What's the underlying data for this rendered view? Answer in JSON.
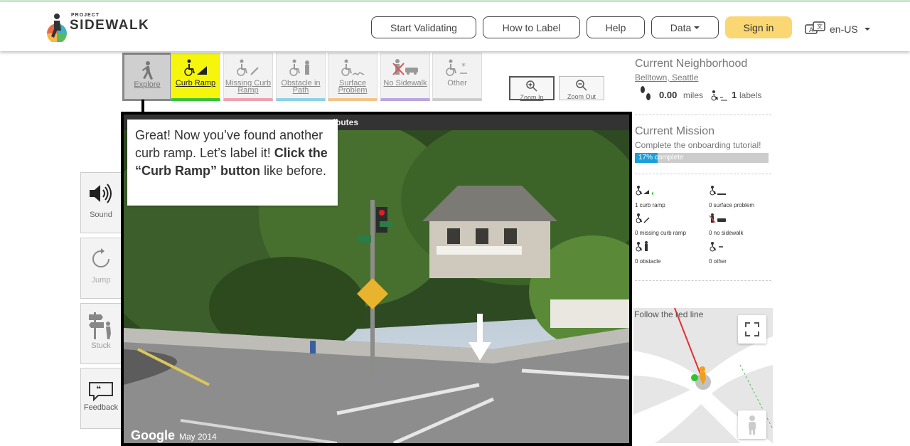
{
  "nav": {
    "logo_small": "PROJECT",
    "logo_big": "SIDEWALK",
    "start_validating": "Start Validating",
    "how_to_label": "How to Label",
    "help": "Help",
    "data": "Data",
    "sign_in": "Sign in",
    "language": "en-US"
  },
  "tools": {
    "explore": "Explore",
    "curb_ramp": "Curb Ramp",
    "missing_curb_ramp": "Missing Curb Ramp",
    "obstacle": "Obstacle in Path",
    "surface_problem": "Surface Problem",
    "no_sidewalk": "No Sidewalk",
    "other": "Other",
    "zoom_in": "Zoom In",
    "zoom_out": "Zoom Out"
  },
  "side": {
    "sound": "Sound",
    "jump": "Jump",
    "stuck": "Stuck",
    "feedback": "Feedback"
  },
  "streetview": {
    "topbar": "ributes",
    "google": "Google",
    "date": "May 2014"
  },
  "tip": {
    "text_plain": "Great! Now you’ve found another curb ramp. Let’s label it!",
    "text_bold": "Click the “Curb Ramp” button",
    "text_end": "like before."
  },
  "panel": {
    "neighborhood_title": "Current Neighborhood",
    "neighborhood_name": "Belltown, Seattle",
    "miles_value": "0.00",
    "miles_unit": "miles",
    "labels_value": "1",
    "labels_unit": "labels",
    "mission_title": "Current Mission",
    "mission_desc": "Complete the onboarding tutorial!",
    "progress_text": "17% complete",
    "progress_fraction": 0.17,
    "stats": {
      "curb_ramp": "1 curb ramp",
      "surface_problem": "0 surface problem",
      "missing_curb_ramp": "0 missing curb ramp",
      "no_sidewalk": "0 no sidewalk",
      "obstacle": "0 obstacle",
      "other": "0 other"
    },
    "map_hint": "Follow the red line"
  },
  "colors": {
    "accent_yellow": "#f6f60d",
    "signin": "#fad772",
    "progress": "#1a9fd9"
  }
}
